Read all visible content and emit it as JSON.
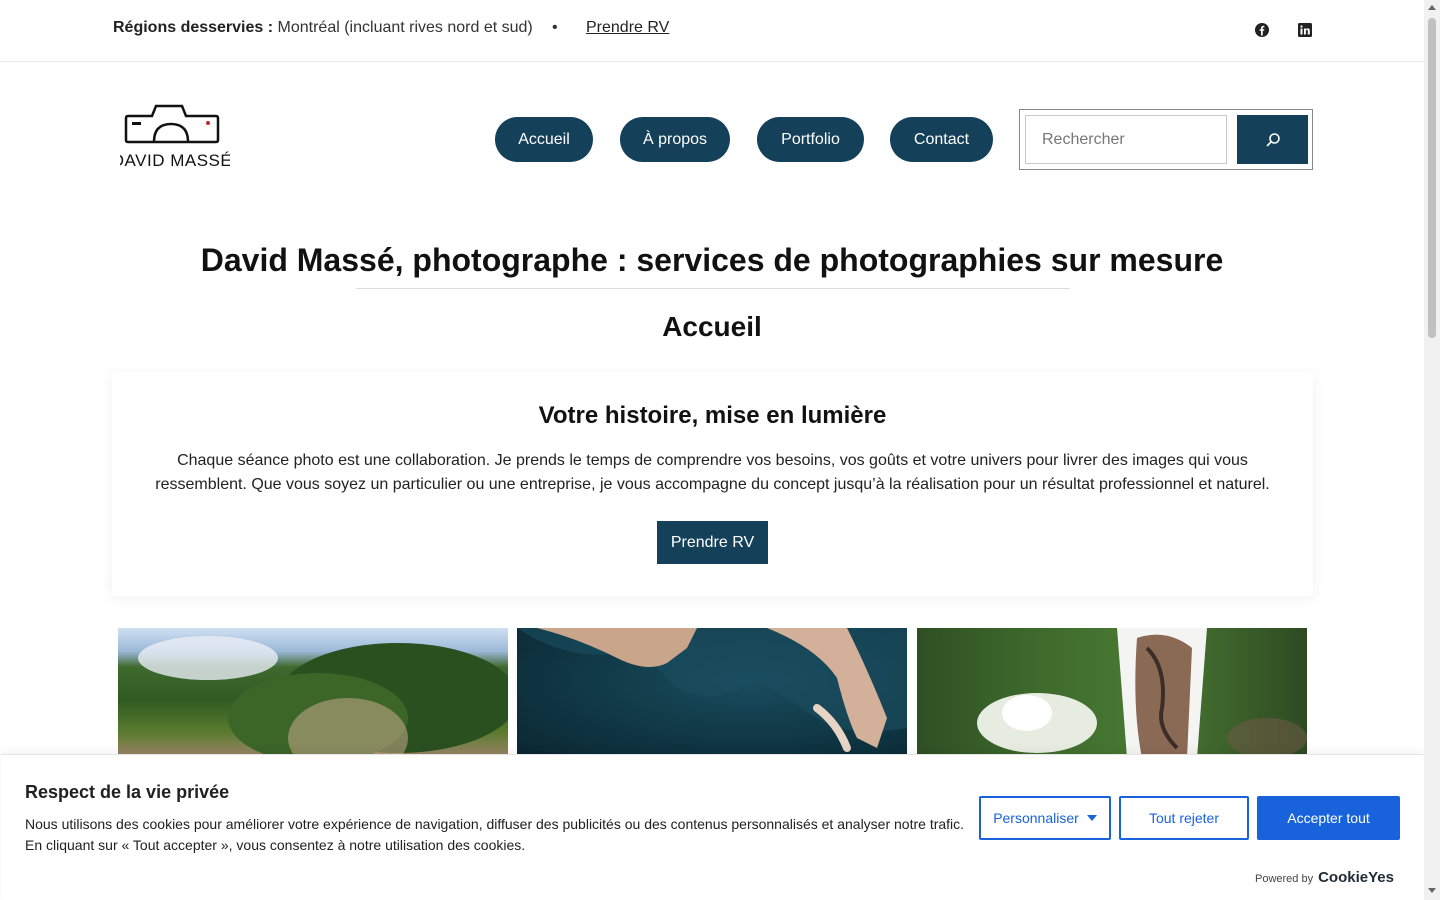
{
  "topbar": {
    "regions_label": "Régions desservies :",
    "regions_value": "Montréal (incluant rives nord et sud)",
    "separator": "•",
    "rv_link": "Prendre RV",
    "social": [
      "facebook-icon",
      "linkedin-icon"
    ]
  },
  "logo": {
    "text": "DAVID MASSÉ"
  },
  "nav": {
    "items": [
      "Accueil",
      "À propos",
      "Portfolio",
      "Contact"
    ]
  },
  "search": {
    "placeholder": "Rechercher",
    "button_icon": "search-icon"
  },
  "main": {
    "page_title": "David Massé, photographe : services de photographies sur mesure",
    "section_title": "Accueil",
    "card": {
      "title": "Votre histoire, mise en lumière",
      "text": "Chaque séance photo est une collaboration. Je prends le temps de comprendre vos besoins, vos goûts et votre univers pour livrer des images qui vous ressemblent. Que vous soyez un particulier ou une entreprise, je vous accompagne du concept jusqu’à la réalisation pour un résultat professionnel et naturel.",
      "button": "Prendre RV"
    }
  },
  "cookie": {
    "title": "Respect de la vie privée",
    "text": "Nous utilisons des cookies pour améliorer votre expérience de navigation, diffuser des publicités ou des contenus personnalisés et analyser notre trafic. En cliquant sur « Tout accepter », vous consentez à notre utilisation des cookies.",
    "customize": "Personnaliser",
    "reject": "Tout rejeter",
    "accept": "Accepter tout",
    "powered_by": "Powered by",
    "brand": "CookieYes"
  },
  "colors": {
    "brand": "#14405a",
    "cookie_accent": "#1863dc"
  }
}
